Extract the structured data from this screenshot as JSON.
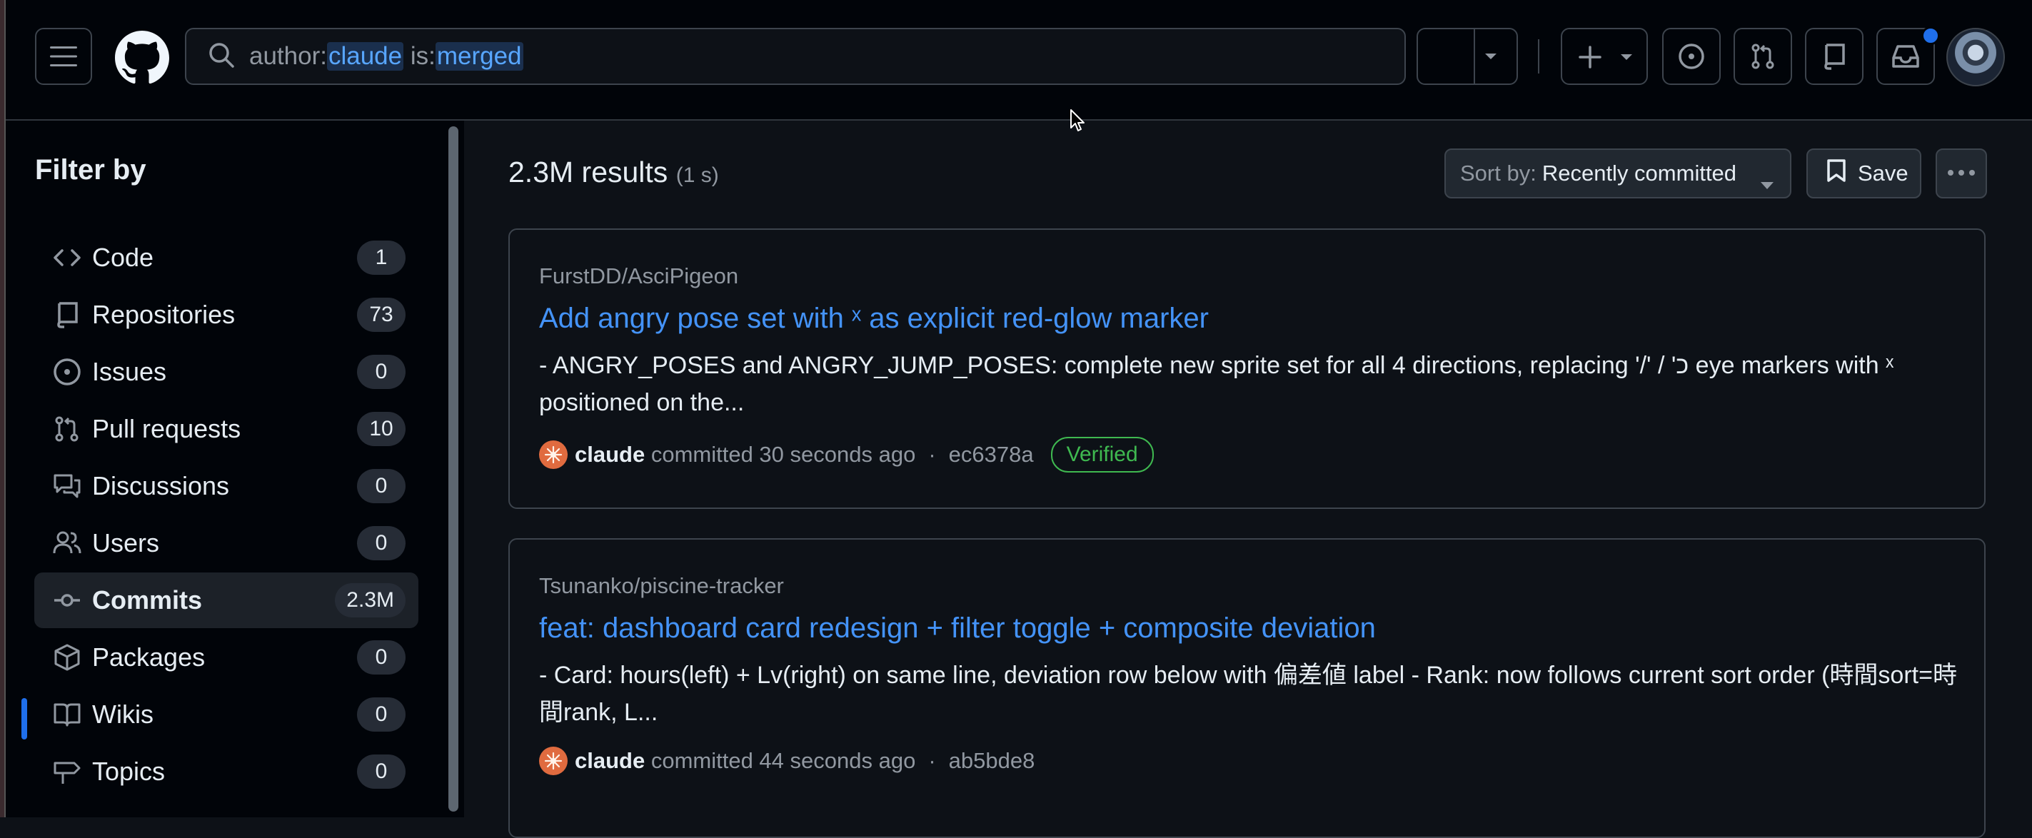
{
  "header": {
    "search_query": {
      "prefix_key": "author:",
      "prefix_value": "claude",
      "space": " ",
      "second_key": "is:",
      "second_value": "merged"
    },
    "has_notification": true
  },
  "sidebar": {
    "title": "Filter by",
    "items": [
      {
        "label": "Code",
        "count": "1",
        "icon": "code-icon"
      },
      {
        "label": "Repositories",
        "count": "73",
        "icon": "repo-icon"
      },
      {
        "label": "Issues",
        "count": "0",
        "icon": "issue-opened-icon"
      },
      {
        "label": "Pull requests",
        "count": "10",
        "icon": "git-pull-request-icon"
      },
      {
        "label": "Discussions",
        "count": "0",
        "icon": "comment-discussion-icon"
      },
      {
        "label": "Users",
        "count": "0",
        "icon": "people-icon"
      },
      {
        "label": "Commits",
        "count": "2.3M",
        "icon": "git-commit-icon",
        "active": true
      },
      {
        "label": "Packages",
        "count": "0",
        "icon": "package-icon"
      },
      {
        "label": "Wikis",
        "count": "0",
        "icon": "book-icon"
      },
      {
        "label": "Topics",
        "count": "0",
        "icon": "tag-icon"
      }
    ]
  },
  "results": {
    "count": "2.3M results",
    "time": "(1 s)"
  },
  "sort": {
    "label": "Sort by:",
    "value": "Recently committed"
  },
  "save_label": "Save",
  "commits": [
    {
      "repo": "FurstDD/AsciPigeon",
      "title": "Add angry pose set with ˣ as explicit red-glow marker",
      "description": "- ANGRY_POSES and ANGRY_JUMP_POSES: complete new sprite set for all 4 directions, replacing '/' / 'כ eye markers with ˣ positioned on the...",
      "author": "claude",
      "action": " committed 30 seconds ago",
      "separator": "·",
      "sha": "ec6378a",
      "verified": "Verified"
    },
    {
      "repo": "Tsunanko/piscine-tracker",
      "title": "feat: dashboard card redesign + filter toggle + composite deviation",
      "description": "- Card: hours(left) + Lv(right) on same line, deviation row below with 偏差値 label - Rank: now follows current sort order (時間sort=時間rank, L...",
      "author": "claude",
      "action": " committed 44 seconds ago",
      "separator": "·",
      "sha": "ab5bde8"
    }
  ],
  "colors": {
    "background": "#0d1117",
    "header_bg": "#010409",
    "link": "#4493f8",
    "verified": "#3fb950",
    "active_indicator": "#1f6feb",
    "muted_text": "#9198a1"
  }
}
